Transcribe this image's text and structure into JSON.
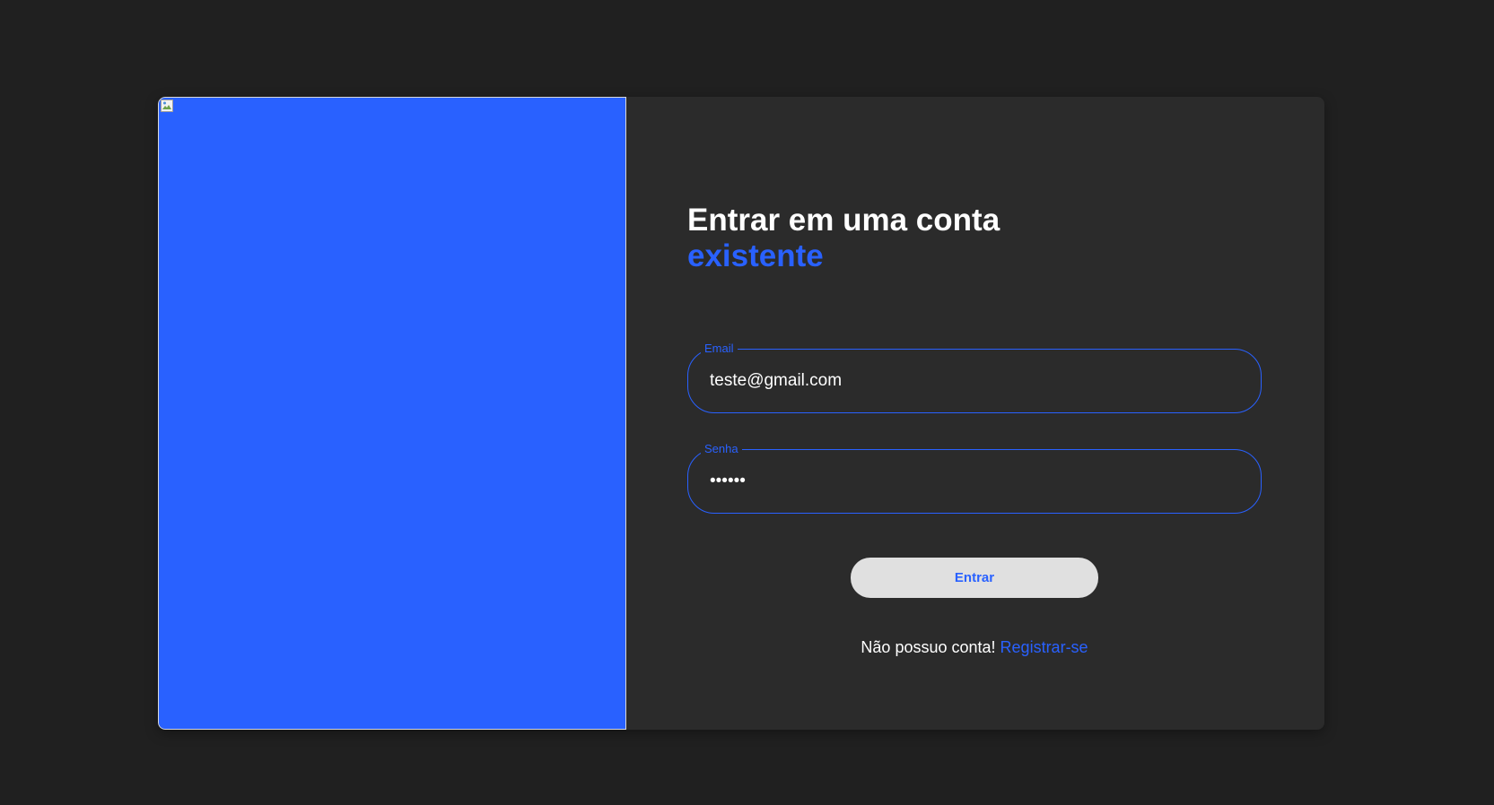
{
  "login": {
    "title_line1": "Entrar em uma conta",
    "title_line2": "existente",
    "email": {
      "label": "Email",
      "value": "teste@gmail.com"
    },
    "password": {
      "label": "Senha",
      "value": "123456"
    },
    "submit_label": "Entrar",
    "register_prompt": "Não possuo conta!",
    "register_link": "Registrar-se"
  },
  "colors": {
    "background": "#202020",
    "card": "#2b2b2b",
    "accent": "#2961ff",
    "button": "#e0e0e0",
    "text": "#ffffff"
  },
  "icons": {
    "image_placeholder": "broken-image-icon"
  }
}
